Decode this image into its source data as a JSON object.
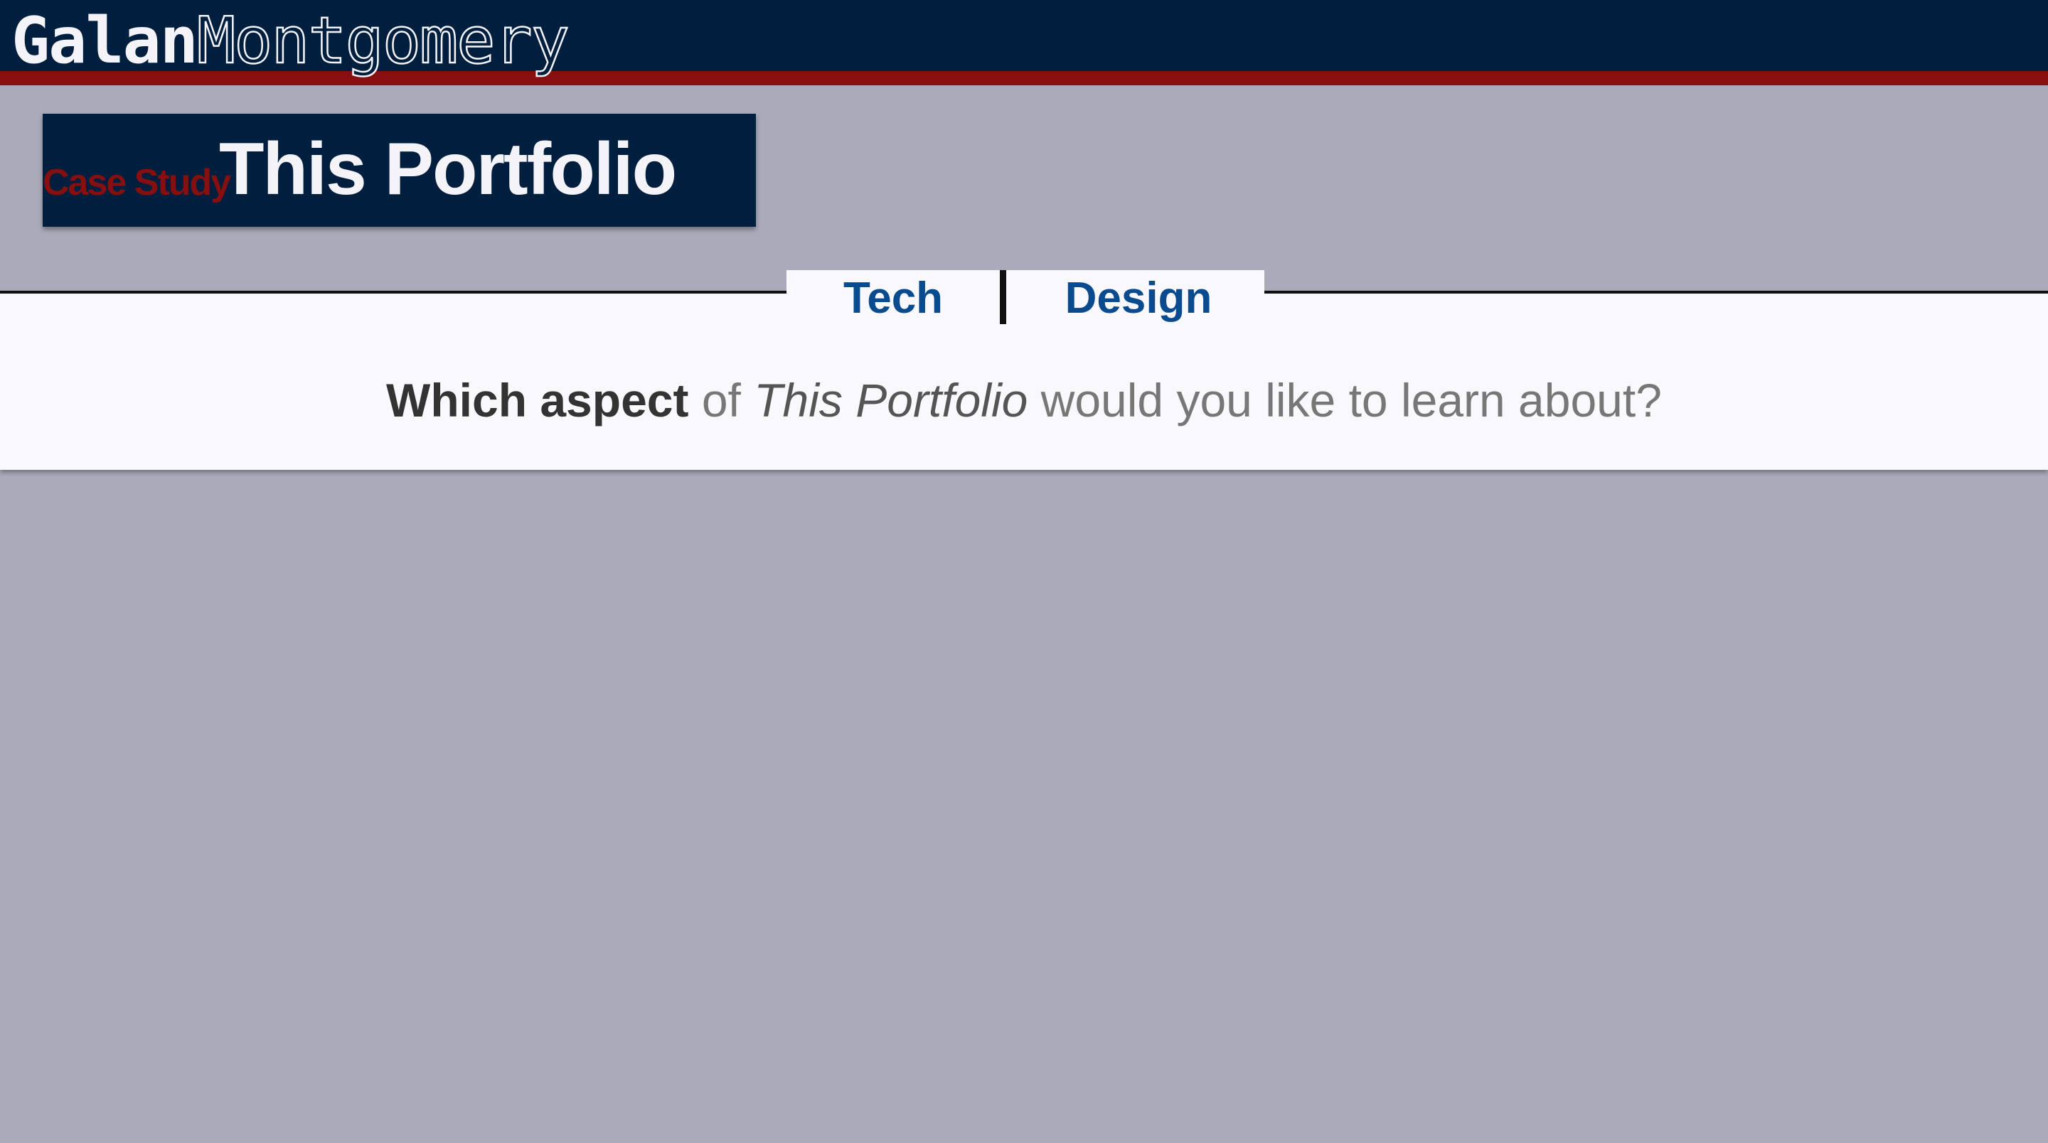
{
  "brand": {
    "first_name": "Galan",
    "last_name": "Montgomery"
  },
  "header": {
    "kicker": "Case Study",
    "title": "This Portfolio"
  },
  "tabs": [
    {
      "label": "Tech"
    },
    {
      "label": "Design"
    }
  ],
  "prompt": {
    "strong": "Which aspect",
    "text_1": " of ",
    "italic": "This Portfolio",
    "text_2": " would you like to learn about?"
  },
  "colors": {
    "navy": "#001e3e",
    "maroon": "#880f10",
    "background": "#aaaaba",
    "panel": "#f8f8fd",
    "link_blue": "#0a4b8f"
  }
}
